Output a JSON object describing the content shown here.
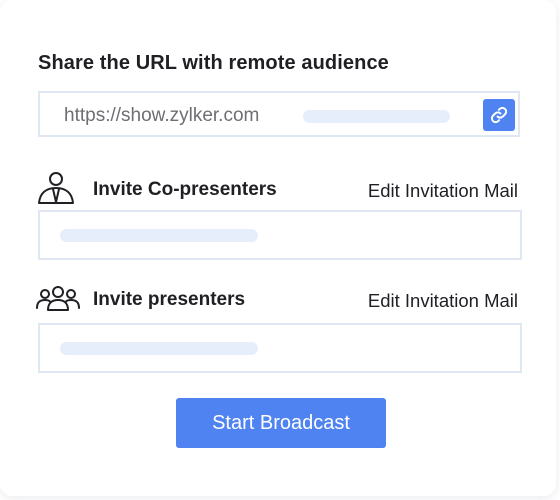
{
  "share": {
    "heading": "Share the URL with remote audience",
    "url": "https://show.zylker.com",
    "copy_icon": "link-icon"
  },
  "co_presenters": {
    "icon": "presenter-icon",
    "label": "Invite Co-presenters",
    "edit_link": "Edit Invitation Mail"
  },
  "presenters": {
    "icon": "group-icon",
    "label": "Invite presenters",
    "edit_link": "Edit Invitation Mail"
  },
  "actions": {
    "start_label": "Start Broadcast"
  },
  "colors": {
    "accent": "#4f83f1",
    "field_border": "#dfe7f3",
    "placeholder": "#e6eefb"
  }
}
